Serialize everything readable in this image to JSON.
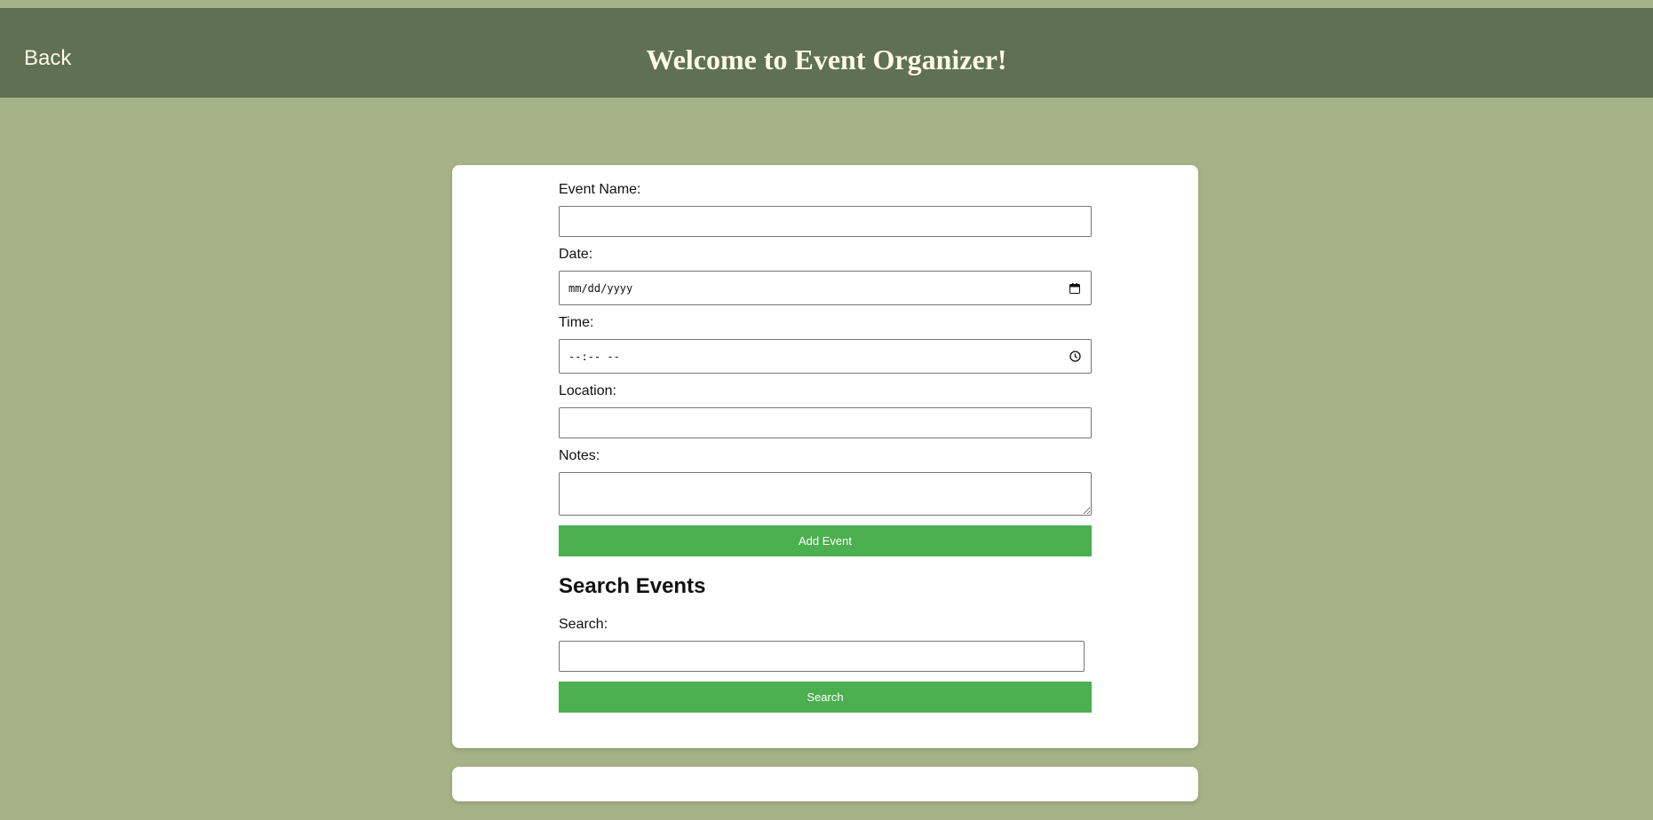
{
  "header": {
    "back_label": "Back",
    "title": "Welcome to Event Organizer!"
  },
  "form": {
    "event_name_label": "Event Name:",
    "event_name_value": "",
    "date_label": "Date:",
    "date_placeholder": "mm/dd/yyyy",
    "time_label": "Time:",
    "time_placeholder": "--:-- --",
    "location_label": "Location:",
    "location_value": "",
    "notes_label": "Notes:",
    "notes_value": "",
    "add_button_label": "Add Event"
  },
  "search": {
    "heading": "Search Events",
    "label": "Search:",
    "value": "",
    "button_label": "Search"
  },
  "icons": {
    "date": "calendar-icon",
    "time": "clock-icon"
  },
  "colors": {
    "page_background": "#a6b387",
    "header_background": "#5f7053",
    "header_text": "#fffbe6",
    "button": "#4caf50",
    "card": "#ffffff"
  }
}
